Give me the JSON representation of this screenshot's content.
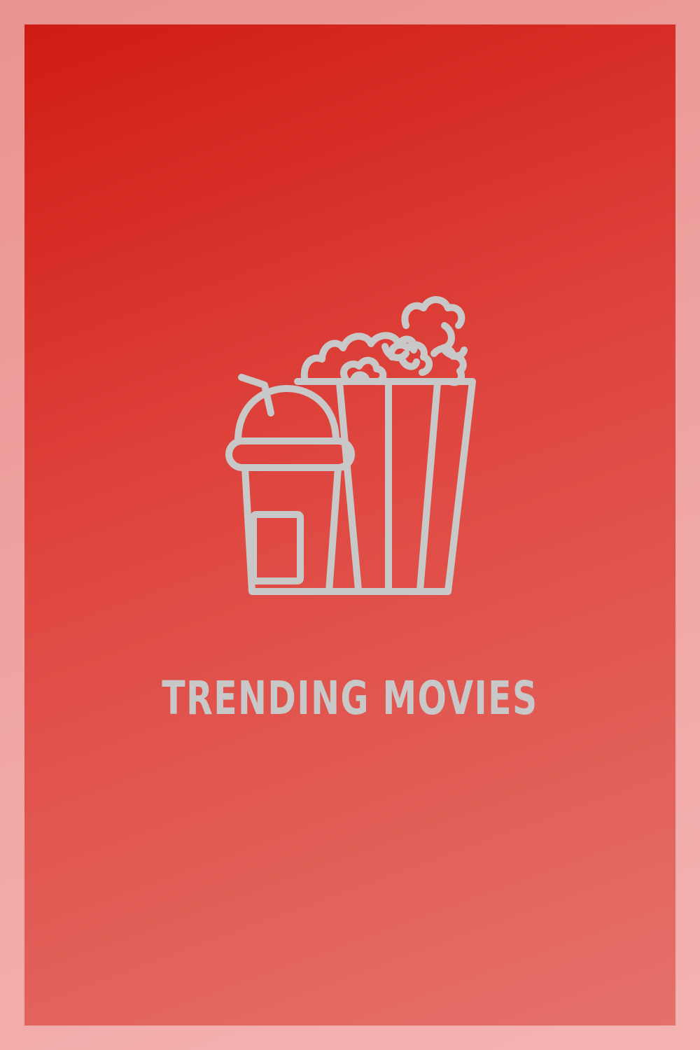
{
  "poster": {
    "icon": "popcorn-and-drink-icon",
    "title": "TRENDING MOVIES"
  },
  "colors": {
    "frame": "#efa3a1",
    "gradient_top": "#d01c14",
    "gradient_bottom": "#e5716b",
    "icon_and_text": "#c8c8c8"
  }
}
